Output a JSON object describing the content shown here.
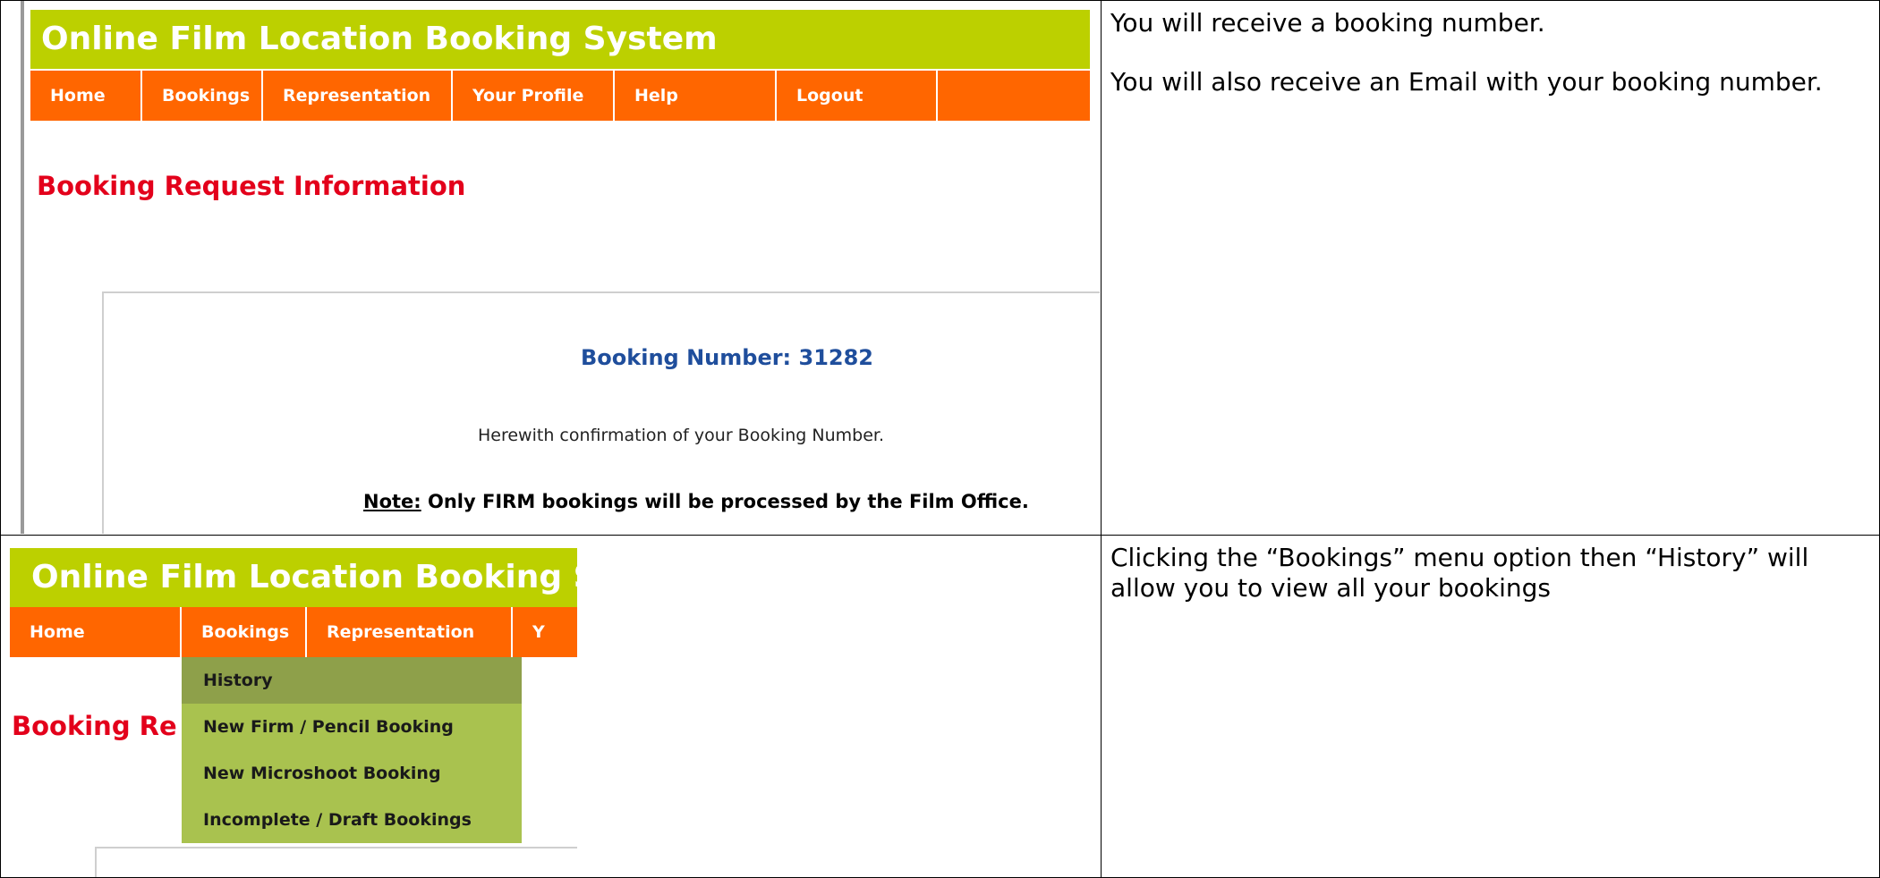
{
  "rows": [
    {
      "screenshot": {
        "header_title": "Online Film Location Booking System",
        "nav": [
          "Home",
          "Bookings",
          "Representation",
          "Your Profile",
          "Help",
          "Logout",
          ""
        ],
        "page_heading": "Booking Request Information",
        "booking_number": "Booking Number: 31282",
        "confirmation_text": "Herewith confirmation of your Booking Number.",
        "note_label": "Note:",
        "note_text": " Only FIRM bookings will be processed by the Film Office."
      },
      "paragraphs": [
        "You will receive a booking number.",
        "You will also receive an Email with your booking number."
      ]
    },
    {
      "screenshot": {
        "header_title": "Online Film Location Booking S",
        "nav": [
          "Home",
          "Bookings",
          "Representation",
          "Y"
        ],
        "page_heading": "Booking Re",
        "dropdown": [
          "History",
          "New Firm / Pencil Booking",
          "New Microshoot Booking",
          "Incomplete / Draft Bookings"
        ],
        "dropdown_active_index": 0
      },
      "paragraphs": [
        "Clicking the “Bookings” menu option then “History” will allow you to view all your bookings"
      ]
    }
  ],
  "colors": {
    "header_green": "#bcd000",
    "nav_orange": "#ff6600",
    "heading_red": "#e3001b",
    "booking_blue": "#1f4e9c",
    "dropdown_green": "#a9c24f",
    "dropdown_active": "#8ea04a"
  }
}
